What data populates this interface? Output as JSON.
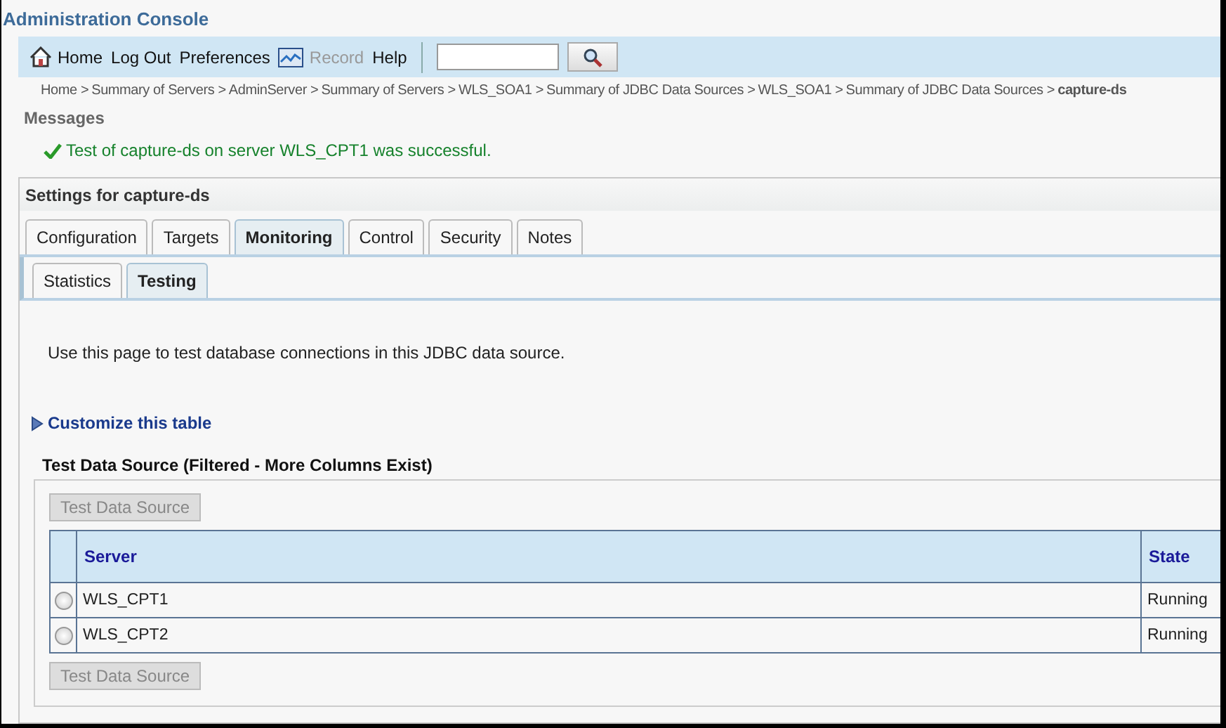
{
  "window": {
    "title": "Administration Console"
  },
  "toolbar": {
    "items": [
      {
        "label": "Home",
        "kind": "home",
        "disabled": false
      },
      {
        "label": "Log Out",
        "kind": "link",
        "disabled": false
      },
      {
        "label": "Preferences",
        "kind": "link",
        "disabled": false
      },
      {
        "label": "Record",
        "kind": "record",
        "disabled": true
      },
      {
        "label": "Help",
        "kind": "link",
        "disabled": false
      }
    ]
  },
  "breadcrumbs": [
    {
      "label": "Home >",
      "current": false
    },
    {
      "label": "Summary of Servers >",
      "current": false
    },
    {
      "label": "AdminServer >",
      "current": false
    },
    {
      "label": "Summary of Servers >",
      "current": false
    },
    {
      "label": "WLS_SOA1 >",
      "current": false
    },
    {
      "label": "Summary of JDBC Data Sources >",
      "current": false
    },
    {
      "label": "WLS_SOA1 >",
      "current": false
    },
    {
      "label": "Summary of JDBC Data Sources >",
      "current": false
    },
    {
      "label": "capture-ds",
      "current": true
    }
  ],
  "messages": {
    "title": "Messages",
    "items": [
      "Test of capture-ds on server WLS_CPT1 was successful."
    ]
  },
  "settings": {
    "title": "Settings for capture-ds",
    "tabs": [
      {
        "label": "Configuration",
        "selected": false
      },
      {
        "label": "Targets",
        "selected": false
      },
      {
        "label": "Monitoring",
        "selected": true
      },
      {
        "label": "Control",
        "selected": false
      },
      {
        "label": "Security",
        "selected": false
      },
      {
        "label": "Notes",
        "selected": false
      }
    ],
    "subtabs": [
      {
        "label": "Statistics",
        "selected": false
      },
      {
        "label": "Testing",
        "selected": true
      }
    ],
    "description": "Use this page to test database connections in this JDBC data source.",
    "customize_link": "Customize this table",
    "table": {
      "title": "Test Data Source (Filtered - More Columns Exist)",
      "top_button": {
        "label": "Test Data Source",
        "disabled": true
      },
      "columns": [
        "Server",
        "State"
      ],
      "rows": [
        {
          "server": "WLS_CPT1",
          "state": "Running",
          "selected": false
        },
        {
          "server": "WLS_CPT2",
          "state": "Running",
          "selected": false
        }
      ],
      "bottom_button": {
        "label": "Test Data Source",
        "disabled": true
      }
    }
  }
}
